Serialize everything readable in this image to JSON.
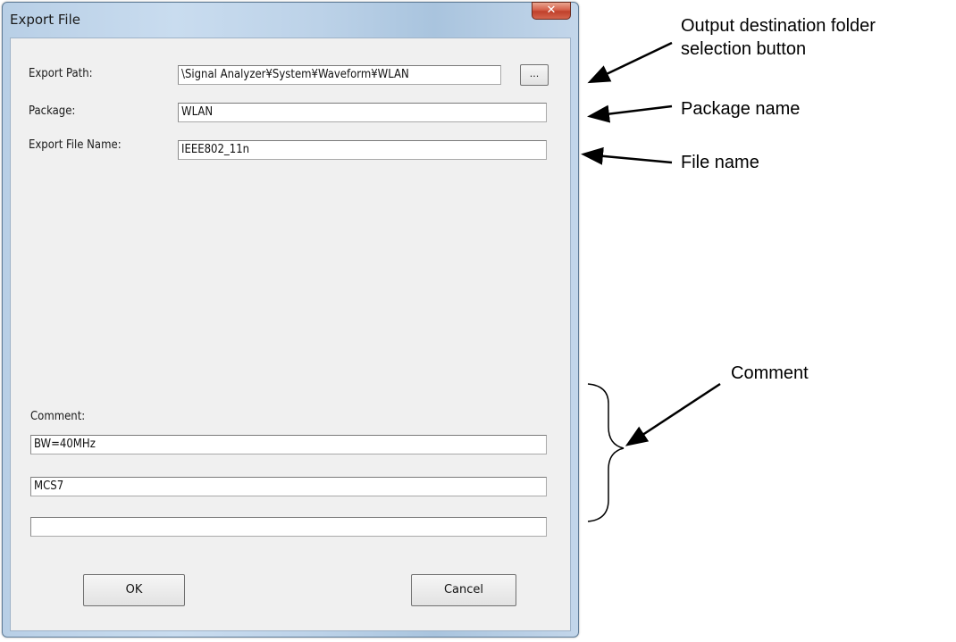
{
  "dialog": {
    "title": "Export File",
    "close_glyph": "✕",
    "export_path": {
      "label": "Export Path:",
      "value": "\\Signal Analyzer¥System¥Waveform¥WLAN",
      "browse_label": "..."
    },
    "package": {
      "label": "Package:",
      "value": "WLAN"
    },
    "file_name": {
      "label": "Export File Name:",
      "value": "IEEE802_11n"
    },
    "comment": {
      "label": "Comment:",
      "lines": [
        "BW=40MHz",
        "MCS7",
        ""
      ]
    },
    "buttons": {
      "ok": "OK",
      "cancel": "Cancel"
    }
  },
  "annotations": {
    "browse_button_line1": "Output destination folder",
    "browse_button_line2": "selection button",
    "package_name": "Package name",
    "file_name": "File name",
    "comment": "Comment"
  },
  "colors": {
    "title_bar": "#c0d4e8",
    "client_bg": "#f0f0f0",
    "close_button": "#c9503a"
  }
}
